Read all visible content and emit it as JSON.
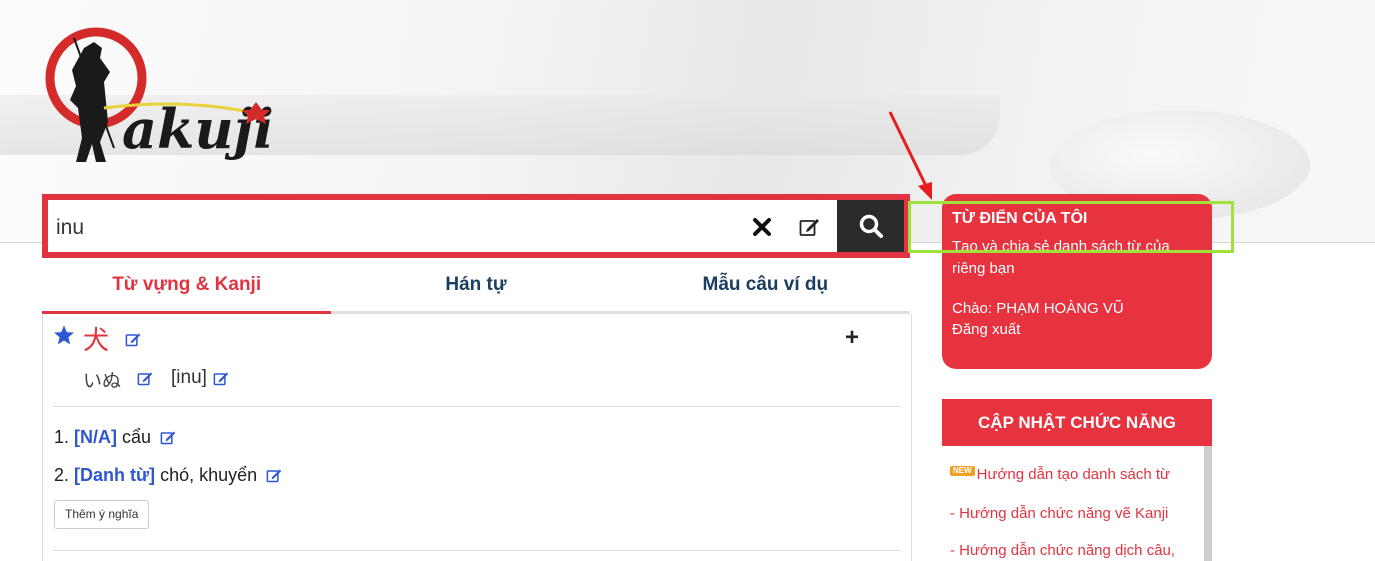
{
  "brand": {
    "logo_text": "akuji"
  },
  "search": {
    "value": "inu"
  },
  "tabs": [
    {
      "label": "Từ vựng & Kanji",
      "active": true
    },
    {
      "label": "Hán tự",
      "active": false
    },
    {
      "label": "Mẫu câu ví dụ",
      "active": false
    }
  ],
  "entry": {
    "kanji": "犬",
    "kana": "いぬ",
    "romaji": "[inu]",
    "meanings": [
      {
        "num": "1.",
        "pos": "[N/A]",
        "text": "cẩu"
      },
      {
        "num": "2.",
        "pos": "[Danh từ]",
        "text": "chó, khuyển"
      }
    ],
    "add_meaning_label": "Thêm ý nghĩa"
  },
  "my_dictionary": {
    "title": "TỪ ĐIỂN CỦA TÔI",
    "description": "Tạo và chia sẻ danh sách từ của riêng bạn",
    "greeting": "Chào: PHẠM HOÀNG VŨ",
    "logout": "Đăng xuất"
  },
  "updates": {
    "title": "CẬP NHẬT CHỨC NĂNG",
    "new_badge": "NEW",
    "items": [
      "Hướng dẫn tạo danh sách từ",
      "- Hướng dẫn chức năng vẽ Kanji",
      "- Hướng dẫn chức năng dịch câu,"
    ]
  },
  "colors": {
    "accent": "#e6333f",
    "link_blue": "#2f57d3",
    "highlight": "#9ee23a",
    "dark": "#2b2b2b"
  }
}
